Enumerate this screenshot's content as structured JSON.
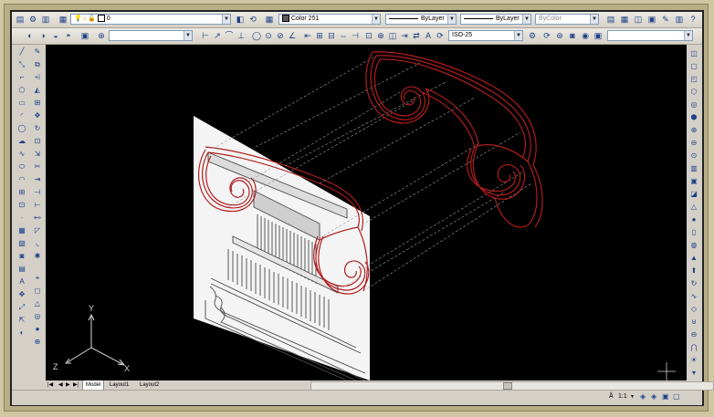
{
  "toolbar1": {
    "layer_value": "0",
    "color_value": "Color 251",
    "linetype_value": "ByLayer",
    "lineweight_value": "ByLayer",
    "plotstyle_value": "ByColor"
  },
  "toolbar2": {
    "dimstyle_value": "ISO-25"
  },
  "ucs": {
    "y_label": "Y",
    "z_label": "Z",
    "x_label": "X"
  },
  "tabs": [
    {
      "label": "Model"
    },
    {
      "label": "Layout1"
    },
    {
      "label": "Layout2"
    }
  ],
  "status": {
    "annotation_scale": "1:1"
  },
  "colors": {
    "profile_red": "#b21c1c",
    "dash_gray": "#9a9a9a",
    "canvas": "#000000"
  }
}
